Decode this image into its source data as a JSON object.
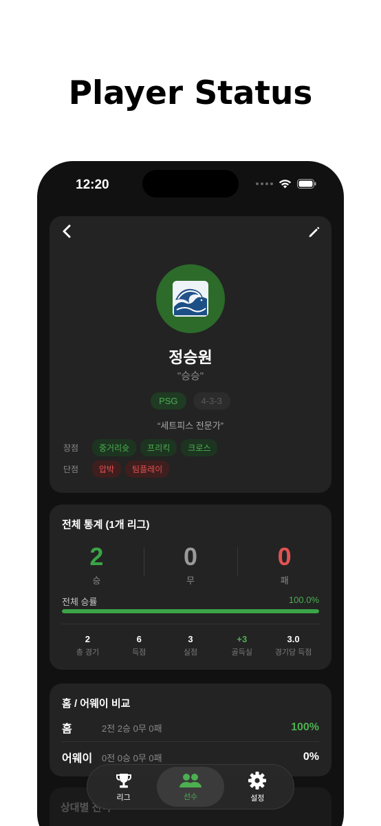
{
  "headline": "Player Status",
  "status_bar": {
    "time": "12:20"
  },
  "profile": {
    "name": "정승원",
    "nickname": "\"승승\"",
    "team": "PSG",
    "formation": "4-3-3",
    "quote": "“세트피스 전문가”",
    "strengths_label": "장점",
    "strengths": [
      "중거리슛",
      "프리킥",
      "크로스"
    ],
    "weaknesses_label": "단점",
    "weaknesses": [
      "압박",
      "팀플레이"
    ],
    "avatar_icon": "wave-icon"
  },
  "overall": {
    "title": "전체 통계 (1개 리그)",
    "wins": "2",
    "wins_label": "승",
    "draws": "0",
    "draws_label": "무",
    "losses": "0",
    "losses_label": "패",
    "win_rate_label": "전체 승률",
    "win_rate_value": "100.0%",
    "win_rate_fraction": 1.0,
    "mini_stats": [
      {
        "value": "2",
        "label": "총 경기"
      },
      {
        "value": "6",
        "label": "득점"
      },
      {
        "value": "3",
        "label": "실점"
      },
      {
        "value": "+3",
        "label": "골득실"
      },
      {
        "value": "3.0",
        "label": "경기당 득점"
      }
    ]
  },
  "home_away": {
    "title": "홈 / 어웨이 비교",
    "home": {
      "name": "홈",
      "detail": "2전  2승 0무 0패",
      "rate": "100%"
    },
    "away": {
      "name": "어웨이",
      "detail": "0전  0승 0무 0패",
      "rate": "0%"
    }
  },
  "next_section": {
    "title": "상대별 전적"
  },
  "tabbar": {
    "league": "리그",
    "players": "선수",
    "settings": "설정"
  },
  "colors": {
    "win": "#3aa447",
    "draw": "#9a9a9a",
    "loss": "#e05252",
    "accent": "#4caf50"
  }
}
